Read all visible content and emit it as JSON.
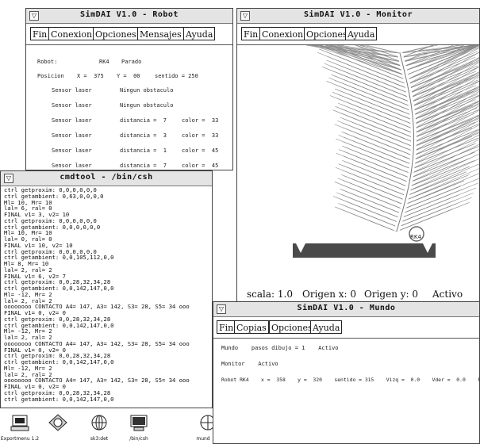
{
  "robot_window": {
    "title": "SimDAI V1.0  -  Robot",
    "menu": [
      "Fin",
      "Conexion",
      "Opciones",
      "Mensajes",
      "Ayuda"
    ],
    "robot_label": "Robot:",
    "robot_name": "RK4",
    "robot_state": "Parado",
    "position_label": "Posicion",
    "x_text": "X =  375",
    "y_text": "Y =  00",
    "direction_text": "sentido = 250",
    "sensors": [
      {
        "name": "Sensor laser",
        "reading": "Ningun obstaculo",
        "color": ""
      },
      {
        "name": "Sensor laser",
        "reading": "Ningun obstaculo",
        "color": ""
      },
      {
        "name": "Sensor laser",
        "reading": "distancia =  7",
        "color": "color =  33"
      },
      {
        "name": "Sensor laser",
        "reading": "distancia =  3",
        "color": "color =  33"
      },
      {
        "name": "Sensor laser",
        "reading": "distancia =  1",
        "color": "color =  45"
      },
      {
        "name": "Sensor laser",
        "reading": "distancia =  7",
        "color": "color =  45"
      }
    ]
  },
  "monitor_window": {
    "title": "SimDAI V1.0  -  Monitor",
    "menu": [
      "Fin",
      "Conexion",
      "Opciones",
      "Ayuda"
    ],
    "robot_tag": "RK4",
    "status": {
      "escala": "scala: 1.0",
      "origen_x": "Origen x:  0",
      "origen_y": "Origen y:  0",
      "state": "Activo"
    }
  },
  "cmdtool_window": {
    "title": "cmdtool - /bin/csh",
    "lines": [
      "ctrl getproxim: 0,0,0,0,0,0",
      "ctrl getambient: 0,63,0,0,0,0",
      "Ml= 10, Mr= 10",
      "lal= 6, ral= 0",
      "FINAL v1= 3, v2= 10",
      "ctrl getproxim: 0,0,0,0,0,0",
      "ctrl getambient: 0,0,0,0,0,0",
      "Ml= 10, Mr= 10",
      "lal= 0, ral= 0",
      "FINAL v1= 10, v2= 10",
      "ctrl getproxim: 0,0,0,0,0,0",
      "ctrl getambient: 0,0,105,112,0,0",
      "Ml= 8, Mr= 10",
      "lal= 2, ral= 2",
      "FINAL v1= 6, v2= 7",
      "ctrl getproxim: 0,0,28,32,34,28",
      "ctrl getambient: 0,0,142,147,0,0",
      "Ml= -12, Mr= 2",
      "lal= 2, ral= 2",
      "oooooooo CONTACTO A4= 147, A3= 142, S3= 28, S5= 34 ooo",
      "FINAL v1= 0, v2= 0",
      "ctrl getproxim: 0,0,28,32,34,28",
      "ctrl getambient: 0,0,142,147,0,0",
      "Ml= -12, Mr= 2",
      "lal= 2, ral= 2",
      "oooooooo CONTACTO A4= 147, A3= 142, S3= 28, S5= 34 ooo",
      "FINAL v1= 0, v2= 0",
      "ctrl getproxim: 0,0,28,32,34,28",
      "ctrl getambient: 0,0,142,147,0,0",
      "Ml= -12, Mr= 2",
      "lal= 2, ral= 2",
      "oooooooo CONTACTO A4= 147, A3= 142, S3= 28, S5= 34 ooo",
      "FINAL v1= 0, v2= 0",
      "ctrl getproxim: 0,0,28,32,34,28",
      "ctrl getambient: 0,0,142,147,0,0"
    ]
  },
  "mundo_window": {
    "title": "SimDAI V1.0  -  Mundo",
    "menu": [
      "Fin",
      "Copias",
      "Opciones",
      "Ayuda"
    ],
    "line1": "Mundo    pasos dibujo = 1    Activo",
    "line2": "Monitor    Activo",
    "line3": "Robot RK4    x =  358    y =  320    sentido = 315    Vizq =  0.0    Vder =  0.0    Parado"
  },
  "dock": [
    {
      "label": "Exportmenu 1.2",
      "icon": "computer-icon"
    },
    {
      "label": "",
      "icon": "globe-icon"
    },
    {
      "label": "sk3:det",
      "icon": "network-icon"
    },
    {
      "label": "/bin/csh",
      "icon": "terminal-icon"
    },
    {
      "label": "mund",
      "icon": "network-icon"
    }
  ],
  "colors": {
    "window_bg": "#ffffff",
    "drawing_gray": "#8a8a8a",
    "floor_dark": "#4a4a4a"
  }
}
